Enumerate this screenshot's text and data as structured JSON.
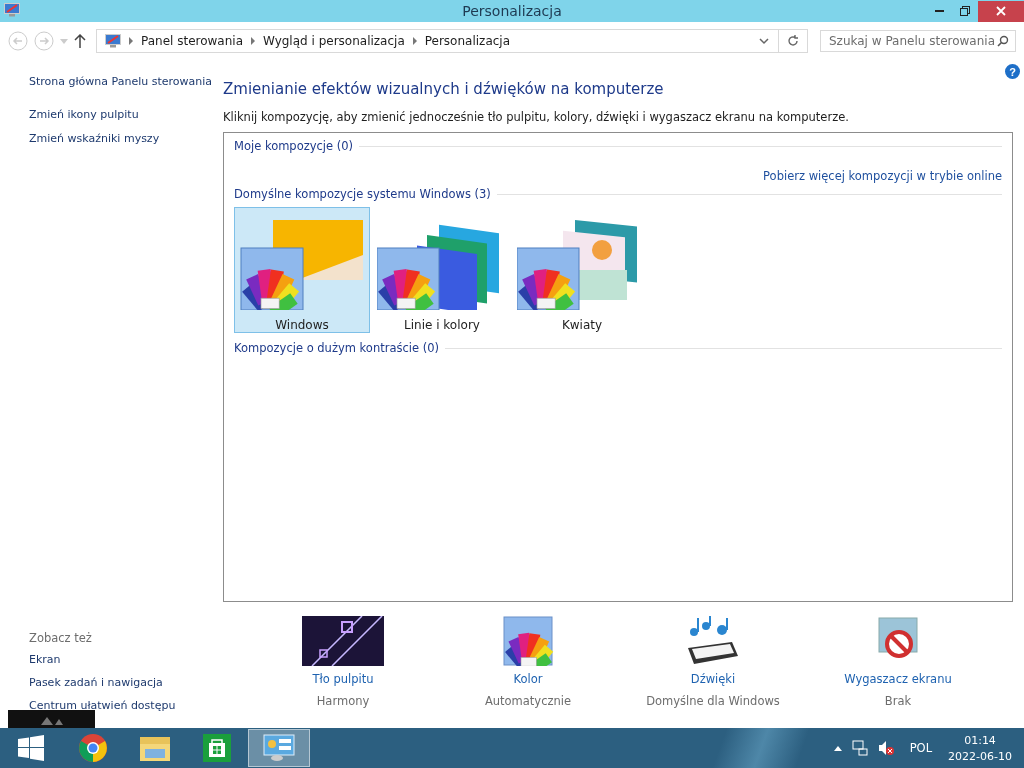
{
  "window": {
    "title": "Personalizacja"
  },
  "address_bar": {
    "breadcrumbs": [
      "Panel sterowania",
      "Wygląd i personalizacja",
      "Personalizacja"
    ]
  },
  "search": {
    "placeholder": "Szukaj w Panelu sterowania"
  },
  "help_button": {
    "label": "?"
  },
  "sidebar": {
    "items": [
      "Strona główna Panelu sterowania",
      "Zmień ikony pulpitu",
      "Zmień wskaźniki myszy"
    ],
    "see_also": {
      "title": "Zobacz też",
      "items": [
        "Ekran",
        "Pasek zadań i nawigacja",
        "Centrum ułatwień dostępu"
      ]
    }
  },
  "main": {
    "heading": "Zmienianie efektów wizualnych i dźwięków na komputerze",
    "description": "Kliknij kompozycję, aby zmienić jednocześnie tło pulpitu, kolory, dźwięki i wygaszacz ekranu na komputerze.",
    "groups": [
      {
        "title": "Moje kompozycje (0)",
        "link": "Pobierz więcej kompozycji w trybie online"
      },
      {
        "title": "Domyślne kompozycje systemu Windows (3)",
        "themes": [
          {
            "name": "Windows",
            "kind": "windows",
            "selected": true
          },
          {
            "name": "Linie i kolory",
            "kind": "lines",
            "selected": false
          },
          {
            "name": "Kwiaty",
            "kind": "flowers",
            "selected": false
          }
        ]
      },
      {
        "title": "Kompozycje o dużym kontraście (0)"
      }
    ]
  },
  "bottom_settings": [
    {
      "kind": "wallpaper",
      "label": "Tło pulpitu",
      "value": "Harmony"
    },
    {
      "kind": "color",
      "label": "Kolor",
      "value": "Automatycznie"
    },
    {
      "kind": "sounds",
      "label": "Dźwięki",
      "value": "Domyślne dla Windows"
    },
    {
      "kind": "screensaver",
      "label": "Wygaszacz ekranu",
      "value": "Brak"
    }
  ],
  "taskbar": {
    "apps": [
      {
        "kind": "start",
        "selected": false
      },
      {
        "kind": "chrome",
        "selected": false
      },
      {
        "kind": "explorer",
        "selected": false
      },
      {
        "kind": "store",
        "selected": false
      },
      {
        "kind": "control",
        "selected": true
      }
    ],
    "language": "POL",
    "time": "01:14",
    "date": "2022-06-10"
  }
}
